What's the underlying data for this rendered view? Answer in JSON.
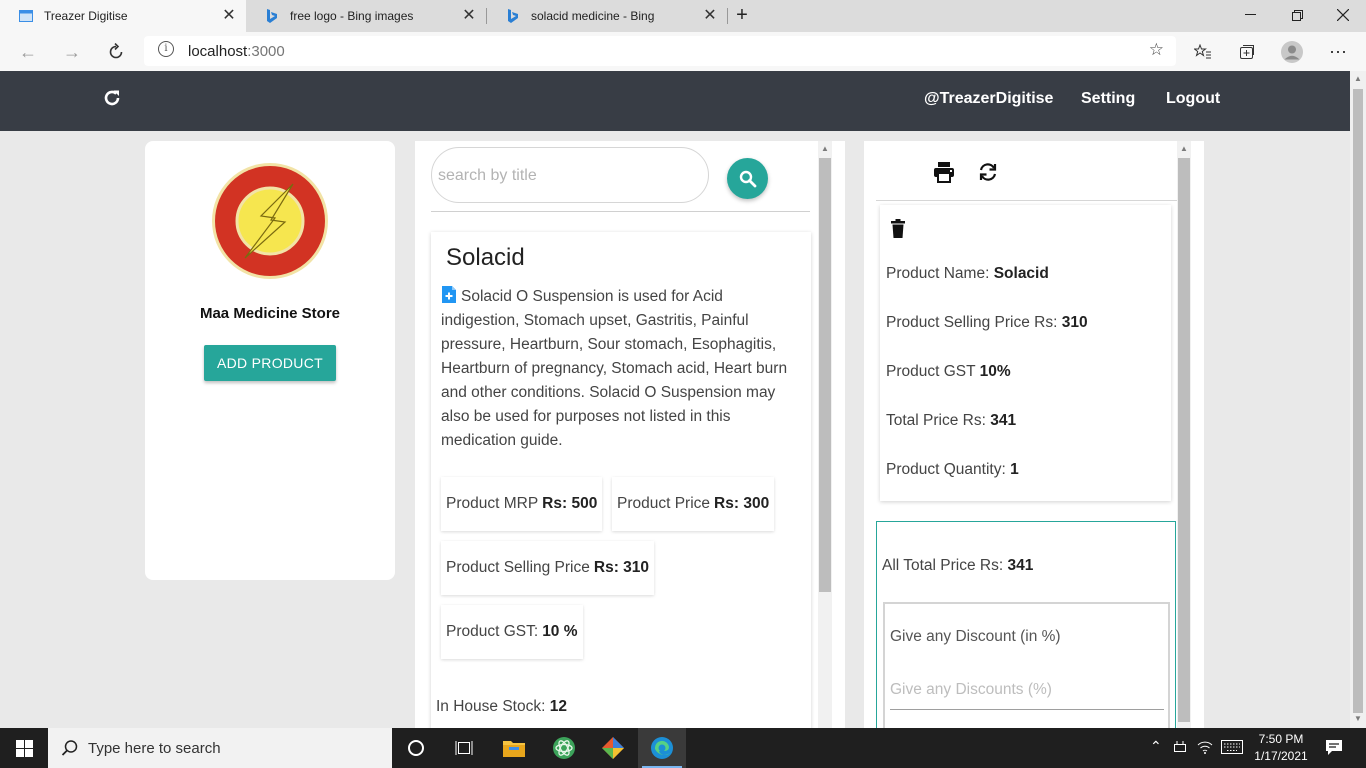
{
  "browser": {
    "tabs": [
      {
        "title": "Treazer Digitise",
        "active": true
      },
      {
        "title": "free logo - Bing images",
        "active": false
      },
      {
        "title": "solacid medicine - Bing",
        "active": false
      }
    ],
    "url_host": "localhost",
    "url_port": ":3000"
  },
  "header": {
    "username": "@TreazerDigitise",
    "setting": "Setting",
    "logout": "Logout"
  },
  "store": {
    "name": "Maa Medicine Store",
    "add_product_label": "ADD PRODUCT"
  },
  "search": {
    "placeholder": "search by title"
  },
  "product": {
    "title": "Solacid",
    "description": "Solacid O Suspension is used for Acid indigestion, Stomach upset, Gastritis, Painful pressure, Heartburn, Sour stomach, Esophagitis, Heartburn of pregnancy, Stomach acid, Heart burn and other conditions. Solacid O Suspension may also be used for purposes not listed in this medication guide.",
    "mrp_label": "Product MRP",
    "mrp_value": "Rs: 500",
    "price_label": "Product Price",
    "price_value": "Rs: 300",
    "selling_label": "Product Selling Price",
    "selling_value": "Rs: 310",
    "gst_label": "Product GST:",
    "gst_value": "10 %",
    "stock_label": "In House Stock:",
    "stock_value": "12"
  },
  "cart_item": {
    "name_label": "Product Name:",
    "name_value": "Solacid",
    "selling_label": "Product Selling Price Rs:",
    "selling_value": "310",
    "gst_label": "Product GST",
    "gst_value": "10%",
    "total_label": "Total Price Rs:",
    "total_value": "341",
    "qty_label": "Product Quantity:",
    "qty_value": "1"
  },
  "totals": {
    "all_total_label": "All Total Price Rs:",
    "all_total_value": "341",
    "discount_label": "Give any Discount (in %)",
    "discount_placeholder": "Give any Discounts (%)"
  },
  "taskbar": {
    "search_text": "Type here to search",
    "time": "7:50 PM",
    "date": "1/17/2021"
  },
  "colors": {
    "accent": "#26a69a",
    "header_bg": "#383d45"
  }
}
